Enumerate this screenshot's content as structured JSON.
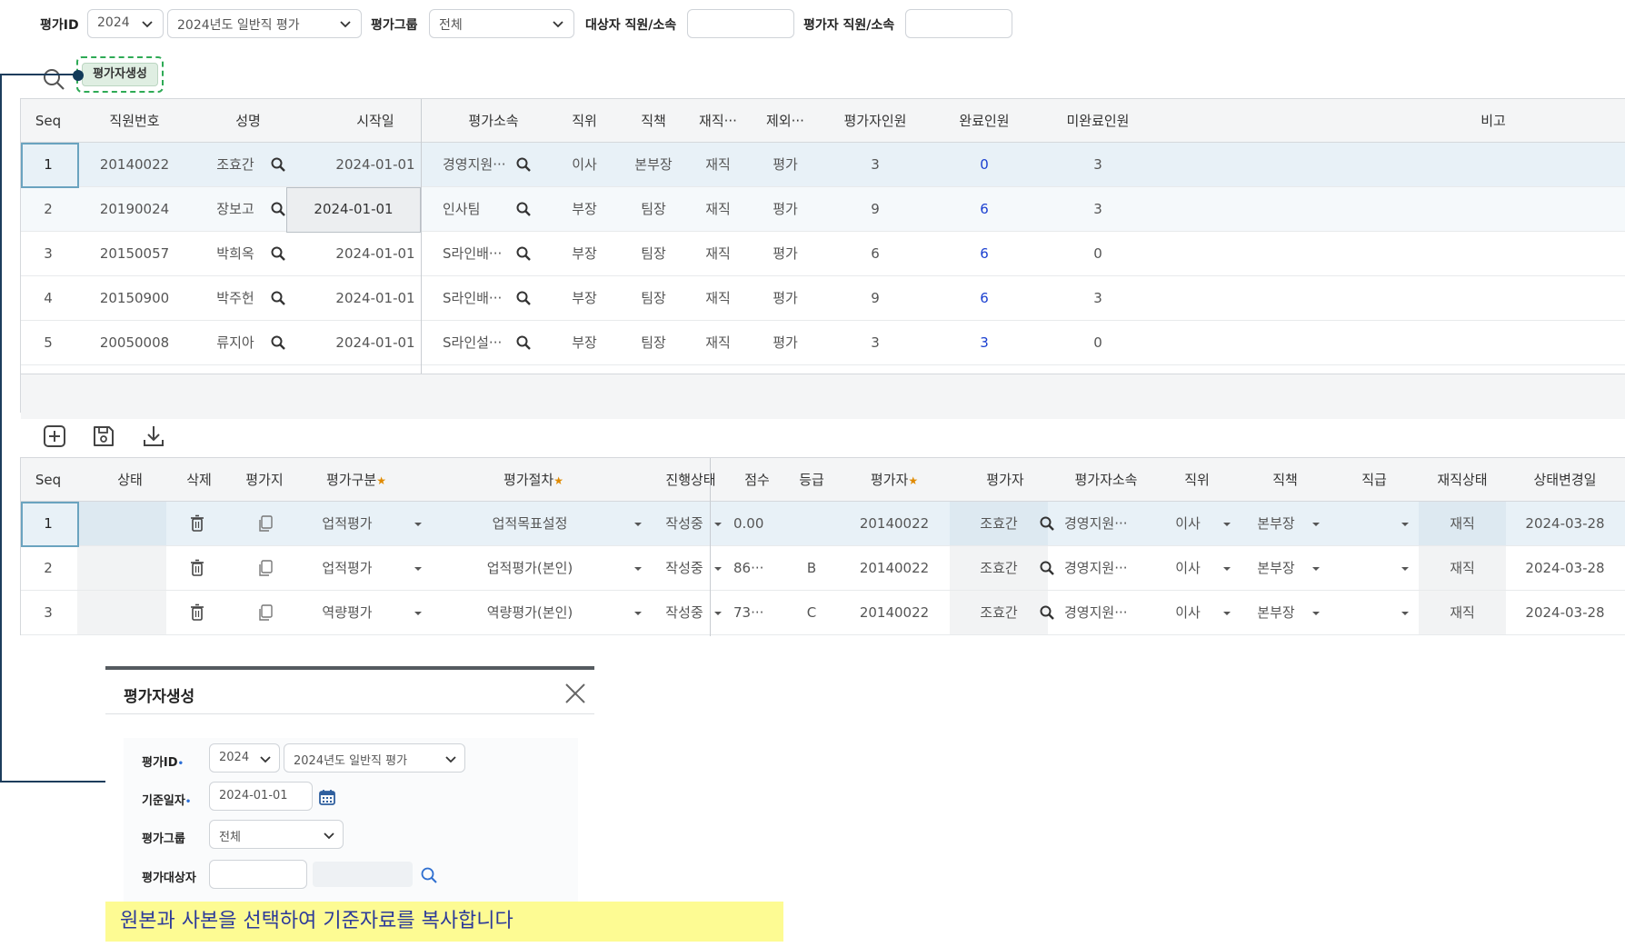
{
  "filter": {
    "eval_id_label": "평가ID",
    "year": "2024",
    "eval_name": "2024년도 일반직 평가",
    "group_label": "평가그룹",
    "group_value": "전체",
    "target_label": "대상자 직원/소속",
    "evaluator_label": "평가자 직원/소속"
  },
  "toolbar": {
    "generate_label": "평가자생성"
  },
  "grid1": {
    "headers": [
      "Seq",
      "직원번호",
      "성명",
      "시작일",
      "평가소속",
      "직위",
      "직책",
      "재직···",
      "제외···",
      "평가자인원",
      "완료인원",
      "미완료인원",
      "비고"
    ],
    "rows": [
      {
        "seq": "1",
        "emp_no": "20140022",
        "name": "조효간",
        "start": "2024-01-01",
        "dept": "경영지원···",
        "position": "이사",
        "duty": "본부장",
        "status": "재직",
        "exclude": "평가",
        "evaluators": "3",
        "done": "0",
        "undone": "3"
      },
      {
        "seq": "2",
        "emp_no": "20190024",
        "name": "장보고",
        "start": "2024-01-01",
        "dept": "인사팀",
        "position": "부장",
        "duty": "팀장",
        "status": "재직",
        "exclude": "평가",
        "evaluators": "9",
        "done": "6",
        "undone": "3"
      },
      {
        "seq": "3",
        "emp_no": "20150057",
        "name": "박희옥",
        "start": "2024-01-01",
        "dept": "S라인배···",
        "position": "부장",
        "duty": "팀장",
        "status": "재직",
        "exclude": "평가",
        "evaluators": "6",
        "done": "6",
        "undone": "0"
      },
      {
        "seq": "4",
        "emp_no": "20150900",
        "name": "박주헌",
        "start": "2024-01-01",
        "dept": "S라인배···",
        "position": "부장",
        "duty": "팀장",
        "status": "재직",
        "exclude": "평가",
        "evaluators": "9",
        "done": "6",
        "undone": "3"
      },
      {
        "seq": "5",
        "emp_no": "20050008",
        "name": "류지아",
        "start": "2024-01-01",
        "dept": "S라인설···",
        "position": "부장",
        "duty": "팀장",
        "status": "재직",
        "exclude": "평가",
        "evaluators": "3",
        "done": "3",
        "undone": "0"
      }
    ]
  },
  "grid2": {
    "headers": [
      "Seq",
      "상태",
      "삭제",
      "평가지",
      "평가구분",
      "평가절차",
      "진행상태",
      "점수",
      "등급",
      "평가자",
      "평가자",
      "평가자소속",
      "직위",
      "직책",
      "직급",
      "재직상태",
      "상태변경일"
    ],
    "required_mark": "★",
    "rows": [
      {
        "seq": "1",
        "category": "업적평가",
        "procedure": "업적목표설정",
        "progress": "작성중",
        "score": "0.00",
        "grade": "",
        "evaluator_no": "20140022",
        "evaluator": "조효간",
        "dept": "경영지원···",
        "position": "이사",
        "duty": "본부장",
        "rank": "",
        "status": "재직",
        "changed": "2024-03-28"
      },
      {
        "seq": "2",
        "category": "업적평가",
        "procedure": "업적평가(본인)",
        "progress": "작성중",
        "score": "86···",
        "grade": "B",
        "evaluator_no": "20140022",
        "evaluator": "조효간",
        "dept": "경영지원···",
        "position": "이사",
        "duty": "본부장",
        "rank": "",
        "status": "재직",
        "changed": "2024-03-28"
      },
      {
        "seq": "3",
        "category": "역량평가",
        "procedure": "역량평가(본인)",
        "progress": "작성중",
        "score": "73···",
        "grade": "C",
        "evaluator_no": "20140022",
        "evaluator": "조효간",
        "dept": "경영지원···",
        "position": "이사",
        "duty": "본부장",
        "rank": "",
        "status": "재직",
        "changed": "2024-03-28"
      }
    ]
  },
  "modal": {
    "title": "평가자생성",
    "eval_id_label": "평가ID",
    "year": "2024",
    "eval_name": "2024년도 일반직 평가",
    "base_date_label": "기준일자",
    "base_date": "2024-01-01",
    "group_label": "평가그룹",
    "group_value": "전체",
    "target_label": "평가대상자",
    "required_mark": "•"
  },
  "note": "원본과 사본을 선택하여 기준자료를 복사합니다",
  "colors": {
    "accent_blue": "#1a3fd0",
    "highlight_yellow": "#fdfb93",
    "dashed_green": "#2eaa55",
    "connector": "#1c3d5c"
  }
}
